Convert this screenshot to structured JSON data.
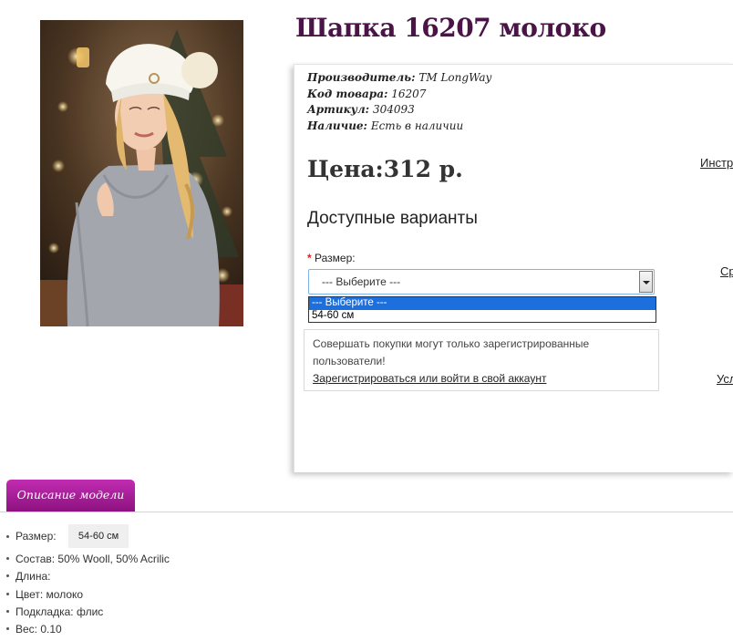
{
  "product": {
    "title": "Шапка 16207 молоко",
    "manufacturer_key": "Производитель:",
    "manufacturer_val": "TM LongWay",
    "code_key": "Код товара:",
    "code_val": "16207",
    "article_key": "Артикул:",
    "article_val": "304093",
    "stock_key": "Наличие:",
    "stock_val": "Есть в наличии",
    "price": "Цена:312 р."
  },
  "side_links": {
    "instr": "Инстр",
    "sr": "Ср",
    "usl": "Усл"
  },
  "variants": {
    "title": "Доступные варианты",
    "required_mark": "*",
    "size_label": "Размер:",
    "selected": "--- Выберите ---",
    "options": [
      "--- Выберите ---",
      "54-60 см"
    ]
  },
  "notice": {
    "text": "Совершать покупки могут только зарегистрированные пользователи!",
    "link": "Зарегистрироваться или войти в свой аккаунт"
  },
  "tabs": {
    "description": "Описание модели"
  },
  "specs": {
    "size_label": "Размер:",
    "size_value": "54-60 см",
    "items": [
      "Состав: 50% Wooll, 50% Acrilic",
      "Длина:",
      "Цвет: молоко",
      "Подкладка: флис",
      "Вес: 0.10"
    ]
  },
  "colors": {
    "title": "#4a1546",
    "tab_top": "#c12cb2",
    "tab_bottom": "#8d127f",
    "select_highlight": "#1e6fde"
  }
}
